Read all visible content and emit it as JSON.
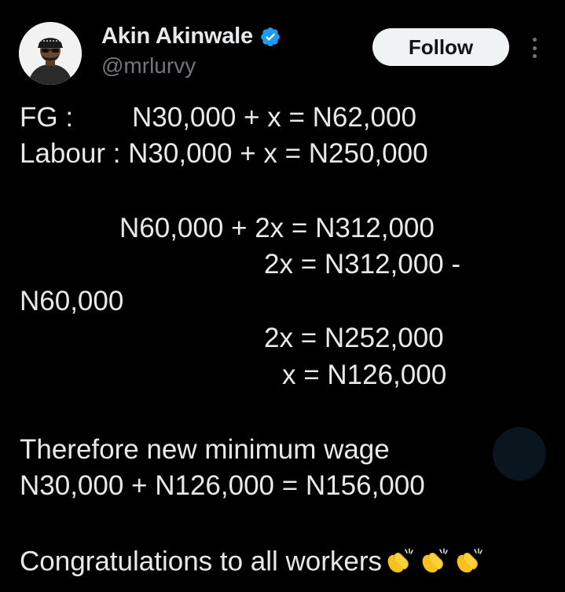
{
  "author": {
    "display_name": "Akin Akinwale",
    "handle": "@mrlurvy",
    "avatar_icon": "profile-photo",
    "verified_icon": "verified-badge-icon",
    "verified_color": "#1d9bf0"
  },
  "actions": {
    "follow_label": "Follow",
    "more_icon": "more-vertical-icon"
  },
  "tweet": {
    "lines": {
      "fg_label": "FG :",
      "fg_eq": "N30,000 + x = N62,000",
      "labour_line": "Labour : N30,000 + x = N250,000",
      "sum_eq": "N60,000 + 2x = N312,000",
      "twox_eq_a": "2x = N312,000 -",
      "twox_eq_b": "N60,000",
      "twox_result": "2x = N252,000",
      "x_result": "x = N126,000",
      "therefore": "Therefore new minimum wage",
      "final_eq": "N30,000 + N126,000 = N156,000",
      "congrats": "Congratulations to all workers"
    },
    "emoji": [
      "clapping-hands",
      "clapping-hands",
      "clapping-hands"
    ]
  },
  "colors": {
    "background": "#000000",
    "text": "#e7e9ea",
    "secondary_text": "#71767b",
    "follow_bg": "#eff3f4"
  }
}
